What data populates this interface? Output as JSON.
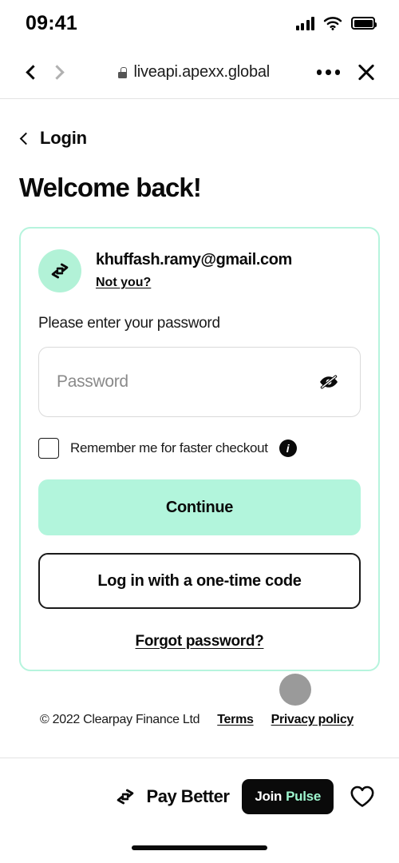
{
  "status_bar": {
    "time": "09:41",
    "signal_icon": "cellular-signal-icon",
    "wifi_icon": "wifi-icon",
    "battery_icon": "battery-full-icon"
  },
  "browser_bar": {
    "back_icon": "chevron-left-icon",
    "forward_icon": "chevron-right-icon",
    "lock_icon": "lock-icon",
    "url": "liveapi.apexx.global",
    "more_icon": "more-horizontal-icon",
    "close_icon": "close-icon"
  },
  "page": {
    "back_label": "Login",
    "back_icon": "chevron-left-icon",
    "heading": "Welcome back!"
  },
  "card": {
    "avatar_icon": "clearpay-logo-icon",
    "email": "khuffash.ramy@gmail.com",
    "not_you_label": "Not you?",
    "prompt": "Please enter your password",
    "password_placeholder": "Password",
    "password_value": "",
    "toggle_password_icon": "eye-off-icon",
    "remember_label": "Remember me for faster checkout",
    "remember_checked": false,
    "info_icon": "info-icon",
    "info_glyph": "i",
    "continue_label": "Continue",
    "one_time_code_label": "Log in with a one-time code",
    "forgot_label": "Forgot password?"
  },
  "footer": {
    "copyright": "© 2022 Clearpay Finance Ltd",
    "terms_label": "Terms",
    "privacy_label": "Privacy policy"
  },
  "cursor": {
    "indicator": "tap-indicator-dot"
  },
  "bottom_bar": {
    "brand_icon": "clearpay-logo-icon",
    "brand_label": "Pay Better",
    "join_label": "Join",
    "pulse_label": "Pulse",
    "favorite_icon": "heart-outline-icon",
    "home_indicator": "home-indicator"
  },
  "colors": {
    "mint_fill": "#b2f5dc",
    "mint_border": "#b6f4dd",
    "avatar_bg": "#b2f2d7",
    "pulse_accent": "#9df5ce",
    "ink": "#0a0a0a",
    "cursor_gray": "#9a9a9a"
  }
}
